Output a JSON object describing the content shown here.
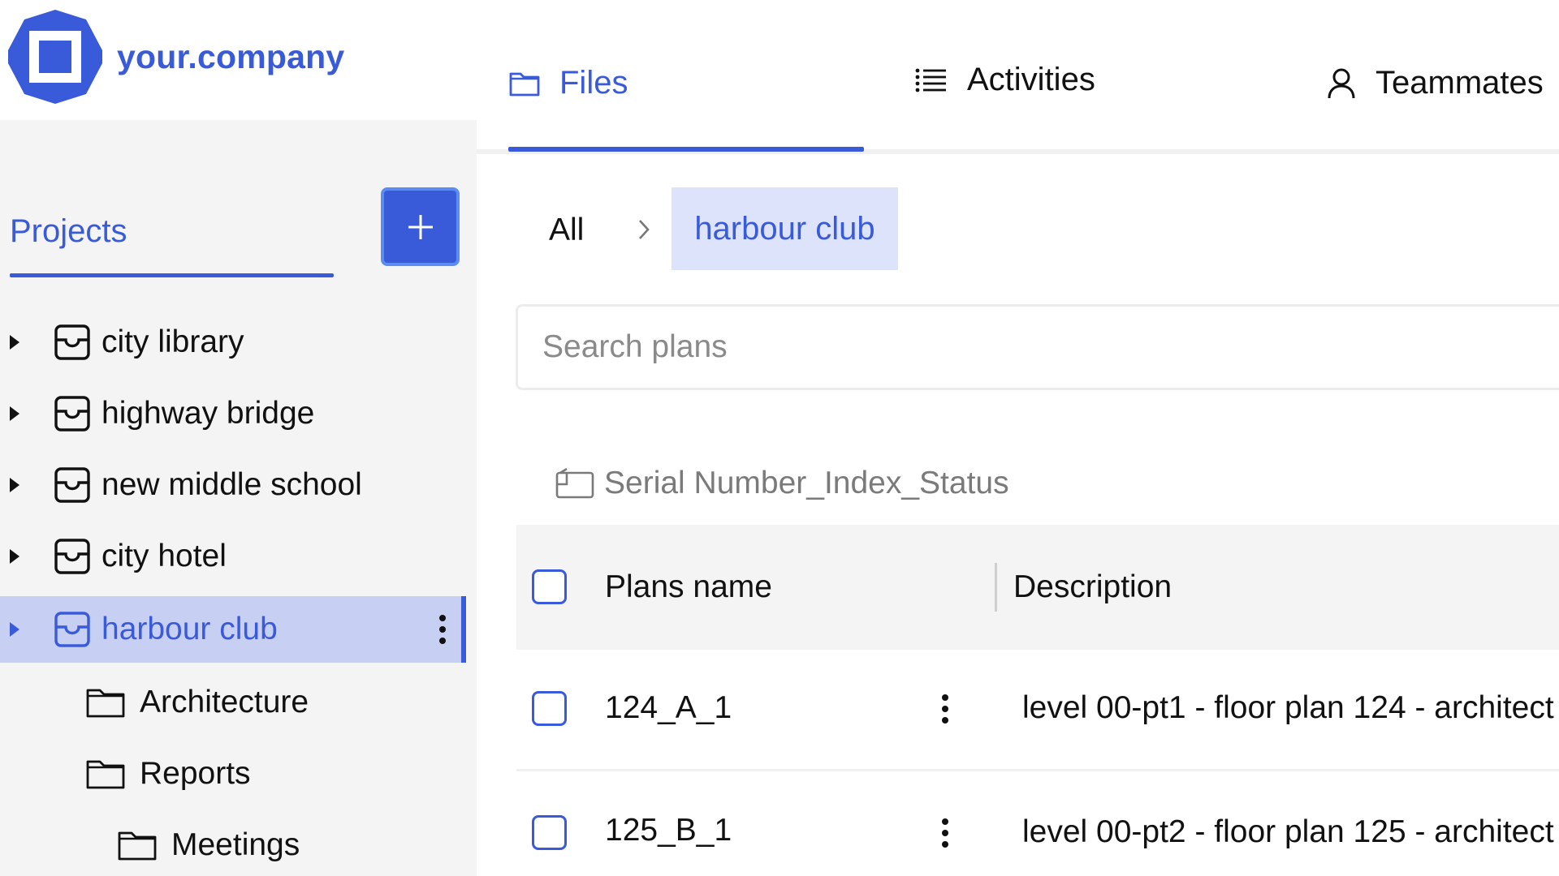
{
  "brand": {
    "name": "your.company",
    "accent": "#3a5bd9"
  },
  "nav": {
    "tabs": [
      {
        "label": "Files",
        "icon": "folder-icon",
        "active": true
      },
      {
        "label": "Activities",
        "icon": "list-icon",
        "active": false
      },
      {
        "label": "Teammates",
        "icon": "user-icon",
        "active": false
      }
    ]
  },
  "sidebar": {
    "tab_label": "Projects",
    "add_icon": "plus-icon",
    "projects": [
      {
        "label": "city library",
        "icon": "inbox-icon"
      },
      {
        "label": "highway bridge",
        "icon": "inbox-icon"
      },
      {
        "label": "new middle school",
        "icon": "inbox-icon"
      },
      {
        "label": "city hotel",
        "icon": "inbox-icon"
      },
      {
        "label": "harbour club",
        "icon": "inbox-icon",
        "selected": true
      }
    ],
    "folders": [
      {
        "label": "Architecture",
        "icon": "folder-icon"
      },
      {
        "label": "Reports",
        "icon": "folder-icon"
      },
      {
        "label": "Meetings",
        "icon": "folder-icon"
      }
    ]
  },
  "breadcrumb": {
    "root": "All",
    "current": "harbour club"
  },
  "search": {
    "placeholder": "Search plans",
    "value": ""
  },
  "grouping": {
    "label": "Serial Number_Index_Status",
    "icon": "label-icon"
  },
  "table": {
    "columns": [
      "Plans name",
      "Description"
    ],
    "rows": [
      {
        "name": "124_A_1",
        "description": "level 00-pt1 - floor plan 124 - architect"
      },
      {
        "name": "125_B_1",
        "description": "level 00-pt2 - floor plan 125 - architect"
      }
    ]
  }
}
